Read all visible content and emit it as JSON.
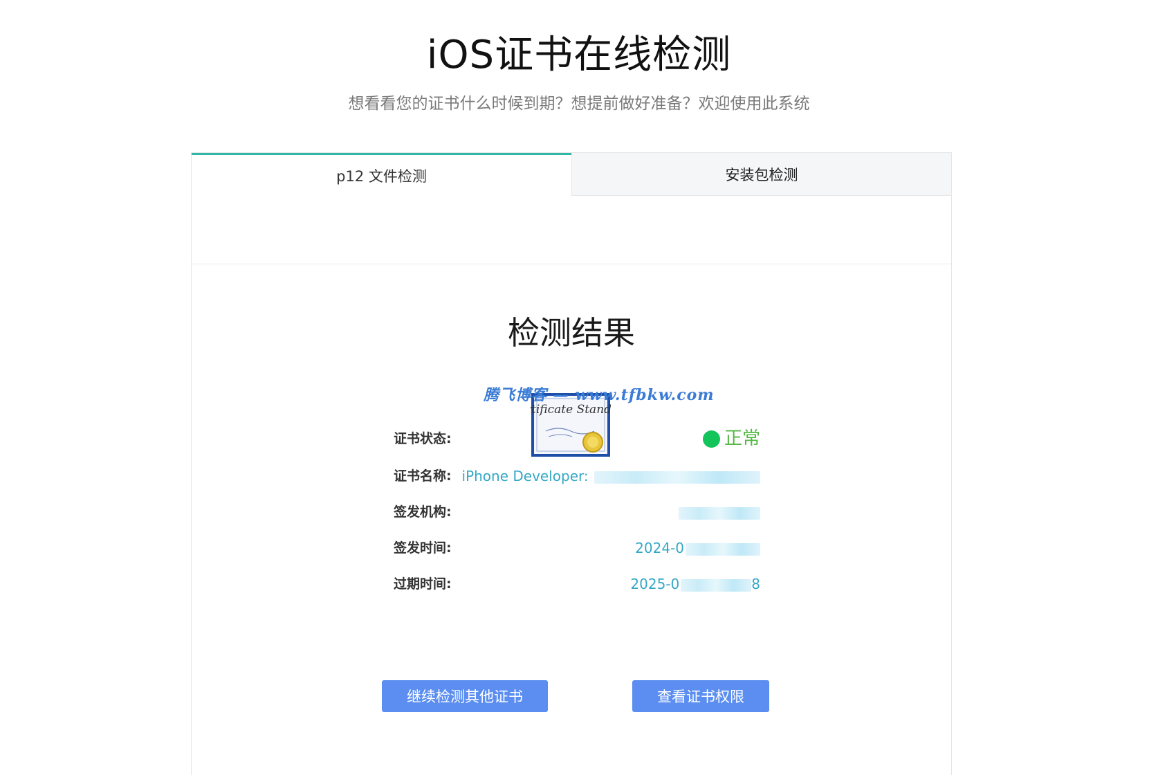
{
  "header": {
    "title": "iOS证书在线检测",
    "subtitle": "想看看您的证书什么时候到期？想提前做好准备？欢迎使用此系统"
  },
  "tabs": [
    {
      "label": "p12 文件检测",
      "active": true
    },
    {
      "label": "安装包检测",
      "active": false
    }
  ],
  "result": {
    "title": "检测结果",
    "watermark": "腾飞博客 — www.tfbkw.com",
    "cert_image_text": "Certificate Standard",
    "rows": [
      {
        "label": "证书状态:",
        "value": "正常"
      },
      {
        "label": "证书名称:",
        "value": "iPhone Developer: "
      },
      {
        "label": "签发机构:",
        "value": ""
      },
      {
        "label": "签发时间:",
        "value": "2024-0"
      },
      {
        "label": "过期时间:",
        "value": "2025-0",
        "suffix": "8"
      }
    ]
  },
  "buttons": {
    "continue": "继续检测其他证书",
    "permissions": "查看证书权限"
  },
  "colors": {
    "tab_accent": "#2fb8a6",
    "status_ok": "#13c45a",
    "value_text": "#35a7c6",
    "button": "#5b8ef0"
  }
}
